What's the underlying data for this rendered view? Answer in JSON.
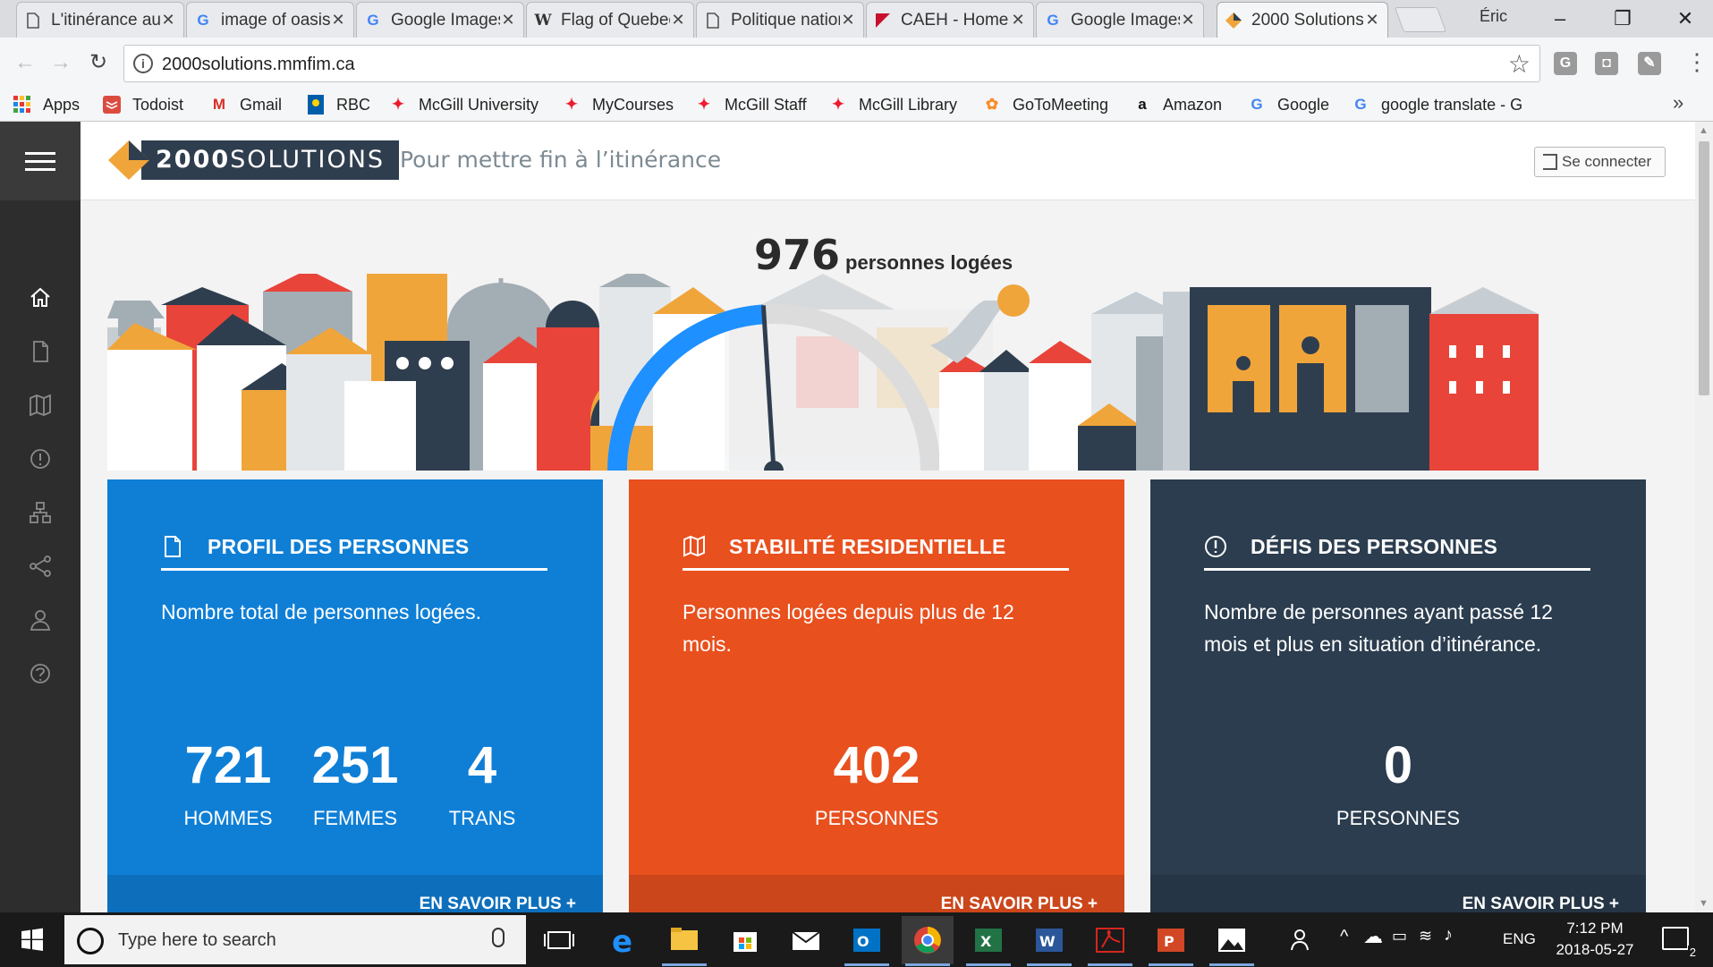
{
  "browser": {
    "tabs": [
      {
        "title": "L'itinérance au Québec",
        "favicon": "doc-icon"
      },
      {
        "title": "image of oasis",
        "favicon": "google-icon"
      },
      {
        "title": "Google Images",
        "favicon": "google-icon"
      },
      {
        "title": "Flag of Quebec",
        "favicon": "wikipedia-icon"
      },
      {
        "title": "Politique nationale",
        "favicon": "doc-icon"
      },
      {
        "title": "CAEH - Home",
        "favicon": "caeh-icon"
      },
      {
        "title": "Google Images",
        "favicon": "google-icon"
      },
      {
        "title": "2000 Solutions",
        "favicon": "2000-icon",
        "active": true
      }
    ],
    "profile": "Éric",
    "url": "2000solutions.mmfim.ca",
    "bookmarks": [
      {
        "label": "Apps",
        "icon": "apps-grid-icon"
      },
      {
        "label": "Todoist",
        "icon": "todoist-icon"
      },
      {
        "label": "Gmail",
        "icon": "gmail-icon"
      },
      {
        "label": "RBC",
        "icon": "rbc-icon"
      },
      {
        "label": "McGill University",
        "icon": "mcgill-icon"
      },
      {
        "label": "MyCourses",
        "icon": "mcgill-icon"
      },
      {
        "label": "McGill Staff",
        "icon": "mcgill-icon"
      },
      {
        "label": "McGill Library",
        "icon": "mcgill-icon"
      },
      {
        "label": "GoToMeeting",
        "icon": "gotomeeting-icon"
      },
      {
        "label": "Amazon",
        "icon": "amazon-icon"
      },
      {
        "label": "Google",
        "icon": "google-icon"
      },
      {
        "label": "google translate - G",
        "icon": "google-icon"
      }
    ],
    "bookmarks_more": "»"
  },
  "site": {
    "brand_bold": "2000",
    "brand_light": "SOLUTIONS",
    "tagline": "Pour mettre fin à l’itinérance",
    "login_label": "Se connecter",
    "counter": {
      "value": "976",
      "label": "personnes logées",
      "gauge_fill": 0.48
    },
    "cards": [
      {
        "title": "PROFIL DES PERSONNES",
        "icon": "document-icon",
        "description": "Nombre total de personnes logées.",
        "color": "#0f7fd6",
        "stats": [
          {
            "value": "721",
            "label": "HOMMES"
          },
          {
            "value": "251",
            "label": "FEMMES"
          },
          {
            "value": "4",
            "label": "TRANS"
          }
        ],
        "more": "EN SAVOIR PLUS +"
      },
      {
        "title": "STABILITÉ RESIDENTIELLE",
        "icon": "map-icon",
        "description": "Personnes logées depuis plus de 12 mois.",
        "color": "#e8501e",
        "stats": [
          {
            "value": "402",
            "label": "PERSONNES"
          }
        ],
        "more": "EN SAVOIR PLUS +"
      },
      {
        "title": "DÉFIS DES PERSONNES",
        "icon": "alert-circle-icon",
        "description": "Nombre de personnes ayant passé 12 mois et plus en situation d’itinérance.",
        "color": "#2b3d4f",
        "stats": [
          {
            "value": "0",
            "label": "PERSONNES"
          }
        ],
        "more": "EN SAVOIR PLUS +"
      }
    ]
  },
  "taskbar": {
    "search_placeholder": "Type here to search",
    "language": "ENG",
    "time": "7:12 PM",
    "date": "2018-05-27",
    "notifications": "2"
  }
}
